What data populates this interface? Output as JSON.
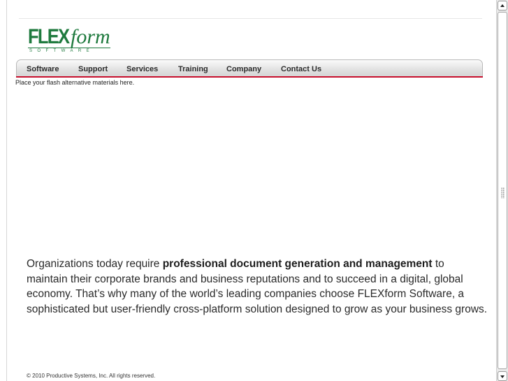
{
  "logo": {
    "brand_bold": "FLEX",
    "brand_italic": "form",
    "tagline": "SOFTWARE",
    "color": "#1f7a3e"
  },
  "nav": {
    "items": [
      {
        "label": "Software"
      },
      {
        "label": "Support"
      },
      {
        "label": "Services"
      },
      {
        "label": "Training"
      },
      {
        "label": "Company"
      },
      {
        "label": "Contact Us"
      }
    ],
    "accent_color": "#c8102e"
  },
  "flash_note": "Place your flash alternative materials here.",
  "intro": {
    "lead": "Organizations today require ",
    "emphasis": "professional document generation and management",
    "rest": " to maintain their corporate brands and business reputations and to succeed in a digital, global economy. That’s why many of the world’s leading companies choose FLEXform Software, a sophisticated but user-friendly cross-platform solution designed to grow as your business grows."
  },
  "footer": {
    "copyright": "© 2010 Productive Systems, Inc. All rights reserved."
  },
  "scrollbar": {
    "up_icon": "arrow-up-icon",
    "down_icon": "arrow-down-icon"
  }
}
